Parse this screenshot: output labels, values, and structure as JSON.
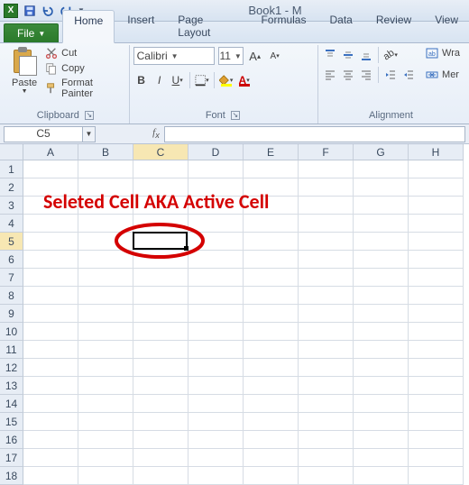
{
  "title": "Book1 - M",
  "qat": {
    "save": "save-icon",
    "undo": "undo-icon",
    "redo": "redo-icon"
  },
  "tabs": {
    "file": "File",
    "items": [
      "Home",
      "Insert",
      "Page Layout",
      "Formulas",
      "Data",
      "Review",
      "View"
    ],
    "active": 0
  },
  "ribbon": {
    "clipboard": {
      "paste": "Paste",
      "cut": "Cut",
      "copy": "Copy",
      "format_painter": "Format Painter",
      "label": "Clipboard"
    },
    "font": {
      "name": "Calibri",
      "size": "11",
      "label": "Font"
    },
    "alignment": {
      "wrap": "Wra",
      "merge": "Mer",
      "label": "Alignment"
    }
  },
  "namebox": "C5",
  "formula": "",
  "columns": [
    "A",
    "B",
    "C",
    "D",
    "E",
    "F",
    "G",
    "H"
  ],
  "sel_col_index": 2,
  "rows": [
    1,
    2,
    3,
    4,
    5,
    6,
    7,
    8,
    9,
    10,
    11,
    12,
    13,
    14,
    15,
    16,
    17,
    18
  ],
  "sel_row_index": 4,
  "annotation": "Seleted Cell AKA Active Cell"
}
